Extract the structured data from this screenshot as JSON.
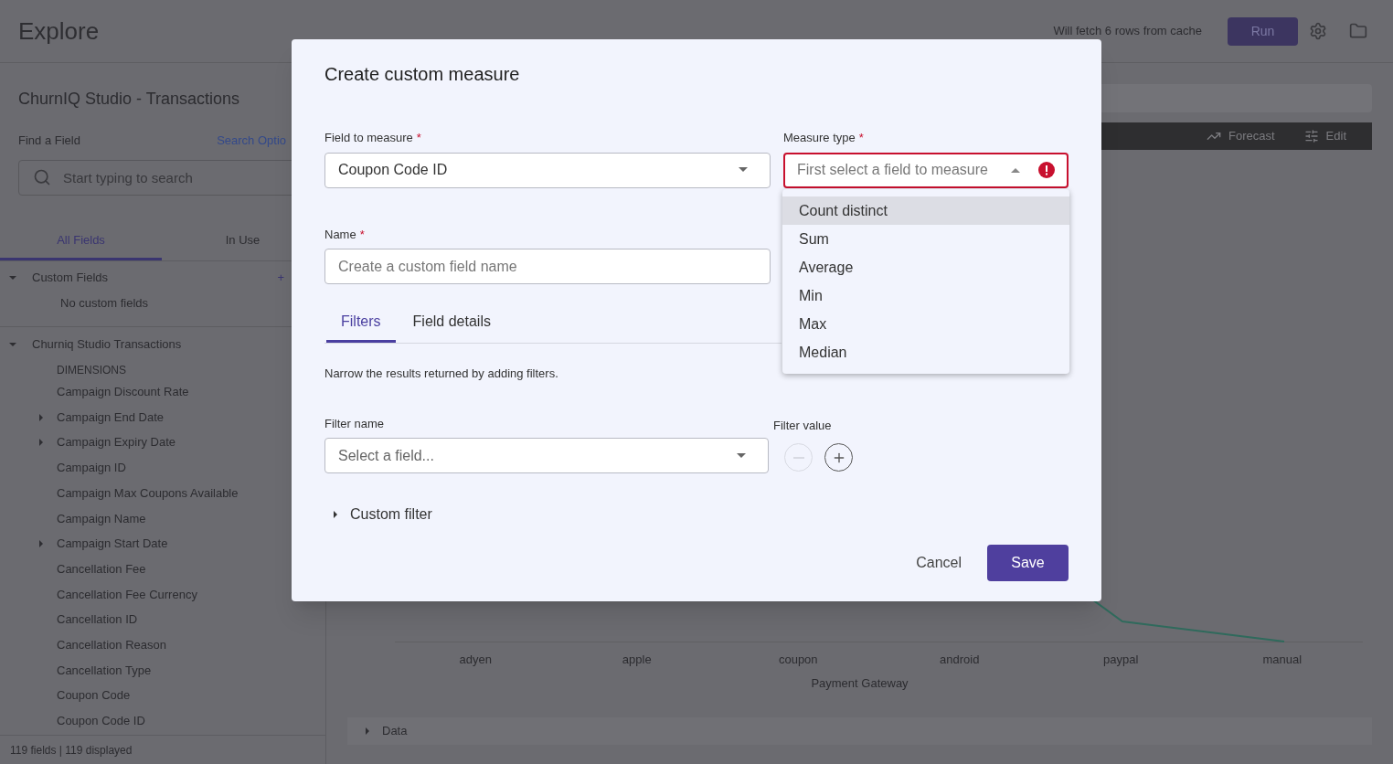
{
  "header": {
    "title": "Explore",
    "cache_note": "Will fetch 6 rows from cache",
    "run_button": "Run"
  },
  "sidebar": {
    "title": "ChurnIQ Studio - Transactions",
    "find_label": "Find a Field",
    "search_options_link": "Search Optio",
    "search": {
      "placeholder": "Start typing to search"
    },
    "tabs": [
      {
        "label": "All Fields",
        "selected": true
      },
      {
        "label": "In Use",
        "selected": false
      }
    ],
    "custom_fields": {
      "title": "Custom Fields",
      "expanded": true,
      "add": "+",
      "empty_note": "No custom fields"
    },
    "field_group": {
      "title": "Churniq Studio Transactions",
      "expanded": true,
      "category": "DIMENSIONS",
      "fields": [
        {
          "label": "Campaign Discount Rate",
          "expandable": false
        },
        {
          "label": "Campaign End Date",
          "expandable": true
        },
        {
          "label": "Campaign Expiry Date",
          "expandable": true
        },
        {
          "label": "Campaign ID",
          "expandable": false
        },
        {
          "label": "Campaign Max Coupons Available",
          "expandable": false
        },
        {
          "label": "Campaign Name",
          "expandable": false
        },
        {
          "label": "Campaign Start Date",
          "expandable": true
        },
        {
          "label": "Cancellation Fee",
          "expandable": false
        },
        {
          "label": "Cancellation Fee Currency",
          "expandable": false
        },
        {
          "label": "Cancellation ID",
          "expandable": false
        },
        {
          "label": "Cancellation Reason",
          "expandable": false
        },
        {
          "label": "Cancellation Type",
          "expandable": false
        },
        {
          "label": "Coupon Code",
          "expandable": false
        },
        {
          "label": "Coupon Code ID",
          "expandable": false
        }
      ]
    },
    "footer": "119 fields | 119 displayed"
  },
  "main": {
    "toolbar": [
      {
        "label": "Forecast",
        "kind": "forecast"
      },
      {
        "label": "Edit",
        "kind": "edit"
      }
    ],
    "chart": {
      "categories": [
        "adyen",
        "apple",
        "coupon",
        "android",
        "paypal",
        "manual"
      ],
      "xlabel": "Payment Gateway"
    },
    "data_section": {
      "label": "Data",
      "expanded": false
    }
  },
  "dialog": {
    "title": "Create custom measure",
    "field_to_measure": {
      "label": "Field to measure",
      "required_mark": "*",
      "value": "Coupon Code ID"
    },
    "measure_type": {
      "label": "Measure type",
      "required_mark": "*",
      "placeholder": "First select a field to measure",
      "error": true,
      "open": true,
      "options": [
        {
          "label": "Count distinct",
          "selected": true
        },
        {
          "label": "Sum",
          "selected": false
        },
        {
          "label": "Average",
          "selected": false
        },
        {
          "label": "Min",
          "selected": false
        },
        {
          "label": "Max",
          "selected": false
        },
        {
          "label": "Median",
          "selected": false
        }
      ]
    },
    "name": {
      "label": "Name",
      "required_mark": "*",
      "placeholder": "Create a custom field name"
    },
    "tabs": [
      {
        "label": "Filters",
        "selected": true
      },
      {
        "label": "Field details",
        "selected": false
      }
    ],
    "filter_hint": "Narrow the results returned by adding filters.",
    "filter_name": {
      "label": "Filter name",
      "placeholder": "Select a field..."
    },
    "filter_value": {
      "label": "Filter value",
      "remove_disabled": true
    },
    "custom_filter": {
      "label": "Custom filter",
      "expanded": false
    },
    "cancel_button": "Cancel",
    "save_button": "Save"
  }
}
